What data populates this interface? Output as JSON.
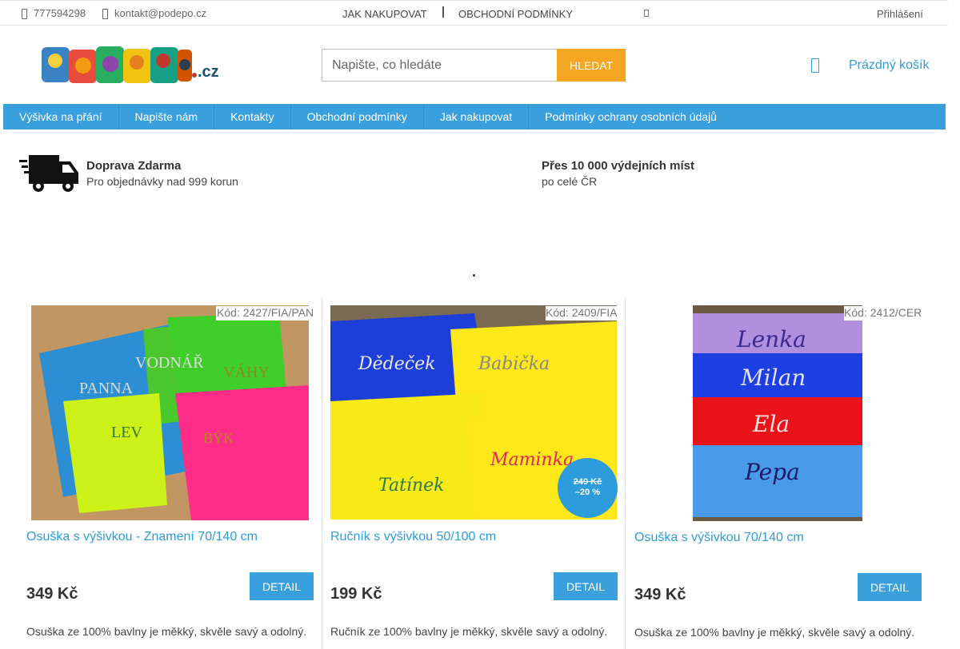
{
  "topbar": {
    "phone": "777594298",
    "email": "kontakt@podepo.cz",
    "link_how_to_buy": "JAK NAKUPOVAT",
    "link_terms": "OBCHODNÍ PODMÍNKY",
    "login": "Přihlášení"
  },
  "header": {
    "logo_text": "PODEPO.cz",
    "search_placeholder": "Napište, co hledáte",
    "search_button": "HLEDAT",
    "cart_label": "Prázdný košík"
  },
  "nav": {
    "items": [
      "Výšivka na přání",
      "Napište nám",
      "Kontakty",
      "Obchodní podmínky",
      "Jak nakupovat",
      "Podmínky ochrany osobních údajů"
    ]
  },
  "benefits": {
    "shipping_title": "Doprava Zdarma",
    "shipping_sub": "Pro objednávky nad 999 korun",
    "pickup_title": "Přes 10 000 výdejních míst",
    "pickup_sub": "po celé ČR"
  },
  "products": [
    {
      "code": "Kód: 2427/FIA/PAN",
      "name": "Osuška s výšivkou - Znamení 70/140 cm",
      "price": "349 Kč",
      "detail": "DETAIL",
      "desc": "Osuška ze 100% bavlny je měkký, skvěle savý a odolný.",
      "towel_texts": [
        "PANNA",
        "VODNÁŘ",
        "VÁHY",
        "LEV",
        "BÝK"
      ]
    },
    {
      "code": "Kód: 2409/FIA",
      "name": "Ručník s výšivkou 50/100 cm",
      "price": "199 Kč",
      "detail": "DETAIL",
      "desc": "Ručník  ze 100% bavlny je měkký, skvěle savý a odolný.",
      "badge_old": "249 Kč",
      "badge_discount": "–20 %",
      "towel_texts": [
        "Dědeček",
        "Babička",
        "Maminka",
        "Tatínek"
      ]
    },
    {
      "code": "Kód: 2412/CER",
      "name": "Osuška s výšivkou 70/140 cm",
      "price": "349 Kč",
      "detail": "DETAIL",
      "desc": "Osuška  ze 100% bavlny je měkký, skvěle savý a odolný.",
      "towel_texts": [
        "Lenka",
        "Milan",
        "Ela",
        "Pepa"
      ]
    }
  ]
}
